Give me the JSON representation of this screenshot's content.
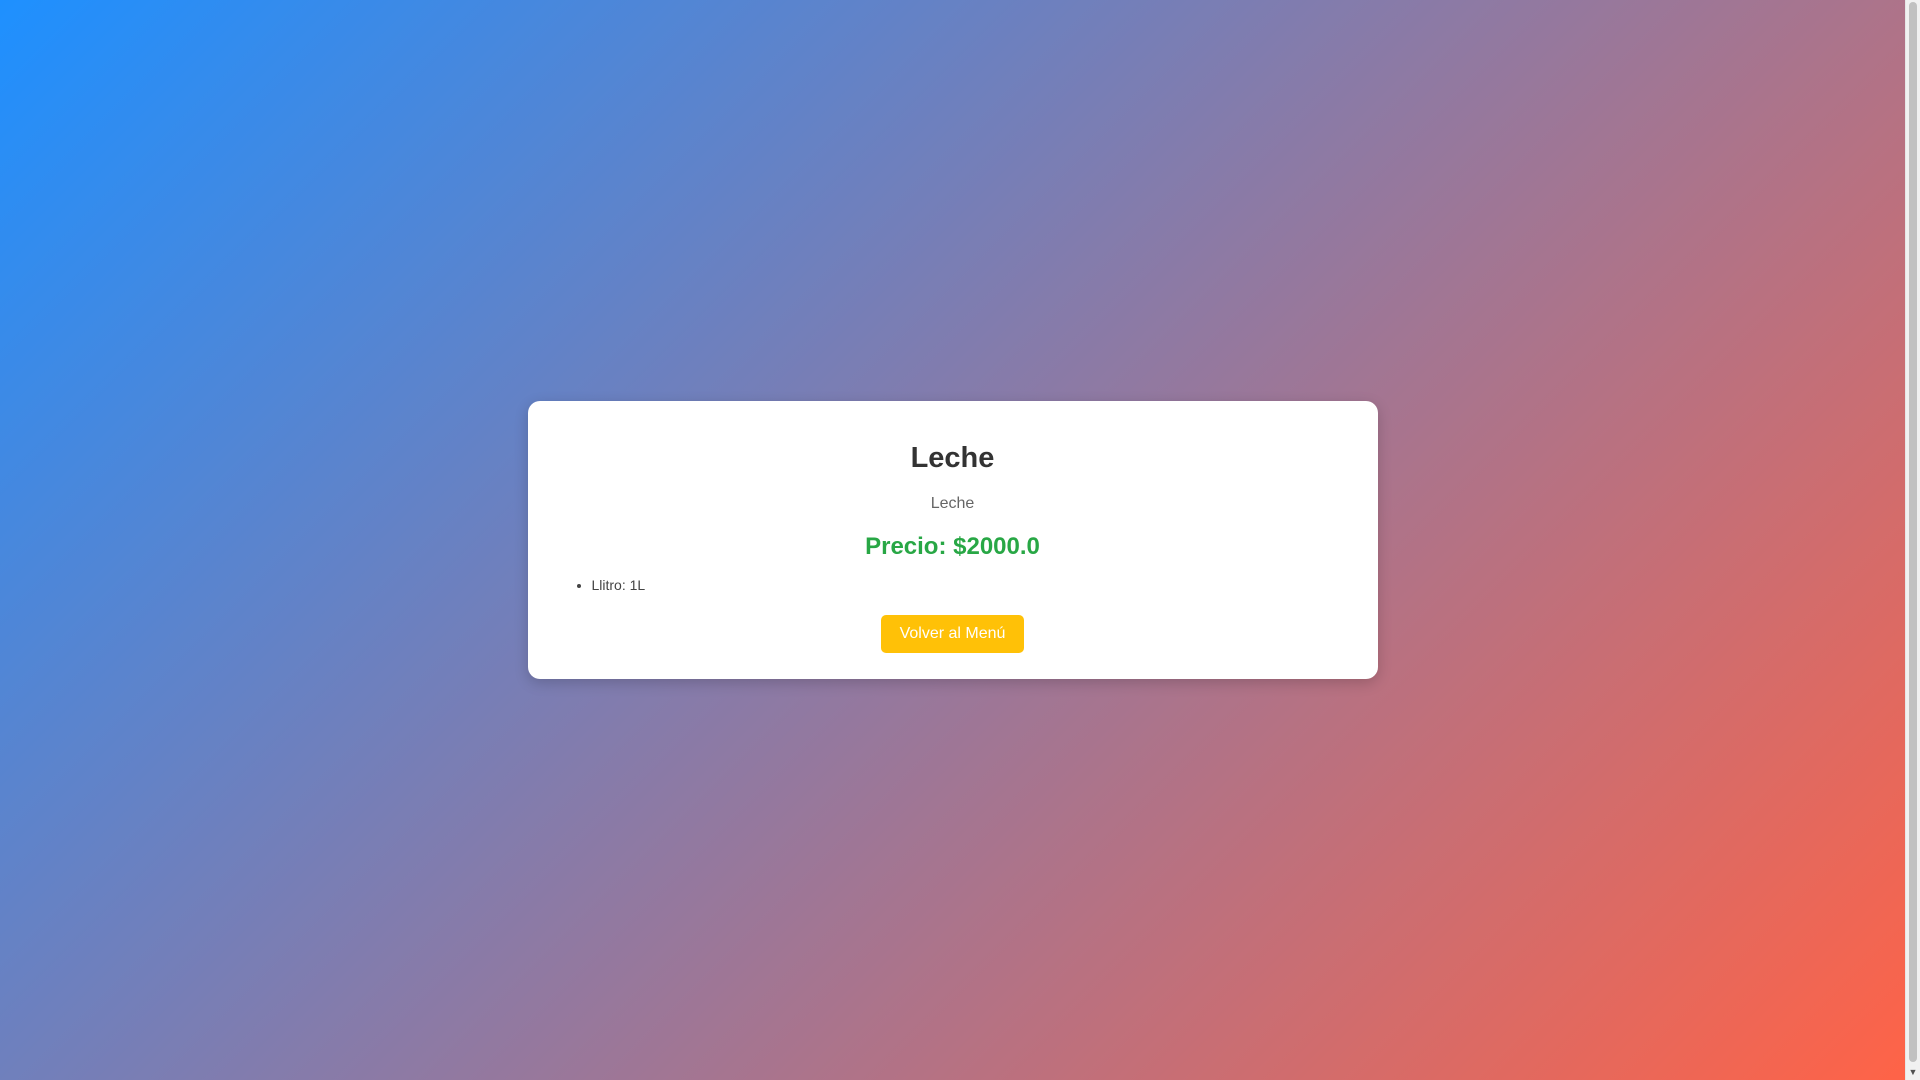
{
  "product": {
    "name": "Leche",
    "description": "Leche",
    "price_label": "Precio: $2000.0",
    "attributes": [
      {
        "text": "Llitro: 1L"
      }
    ]
  },
  "actions": {
    "back_label": "Volver al Menú"
  },
  "colors": {
    "gradient_start": "#1e90ff",
    "gradient_end": "#ff6347",
    "price": "#28a745",
    "button": "#ffc107"
  },
  "icons": {
    "scroll_down": "chevron-down-icon"
  }
}
